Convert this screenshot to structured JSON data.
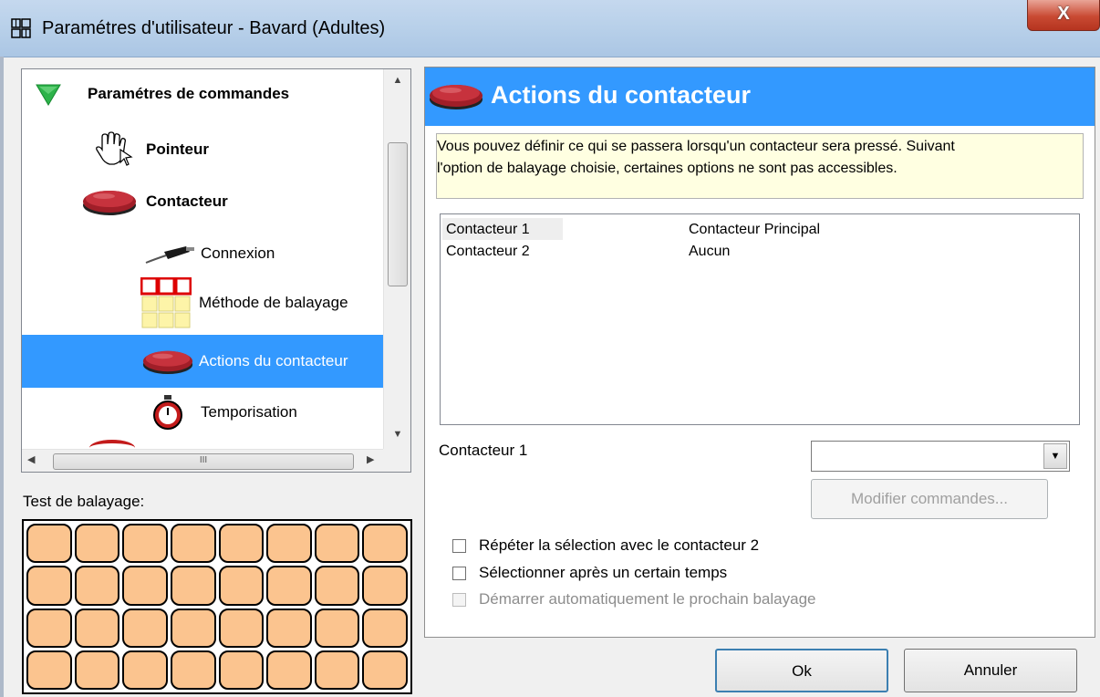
{
  "window": {
    "title": "Paramétres d'utilisateur - Bavard (Adultes)",
    "close_label": "X"
  },
  "tree": {
    "items": [
      {
        "label": "Paramétres de commandes",
        "icon": "green-triangle-icon",
        "bold": true
      },
      {
        "label": "Pointeur",
        "icon": "hand-pointer-icon",
        "bold": true
      },
      {
        "label": "Contacteur",
        "icon": "red-switch-icon",
        "bold": true
      },
      {
        "label": "Connexion",
        "icon": "cable-plug-icon",
        "bold": false
      },
      {
        "label": "Méthode de balayage",
        "icon": "scan-grid-icon",
        "bold": false
      },
      {
        "label": "Actions du contacteur",
        "icon": "red-switch-icon",
        "bold": false,
        "selected": true
      },
      {
        "label": "Temporisation",
        "icon": "stopwatch-icon",
        "bold": false
      }
    ],
    "hscroll_grip": "III"
  },
  "scan_test": {
    "label": "Test de balayage:",
    "rows": 4,
    "cols": 8,
    "cell_color": "#fbc48f"
  },
  "panel": {
    "title": "Actions du contacteur",
    "header_color": "#3399ff",
    "info_line1": "Vous pouvez définir ce qui se passera lorsqu'un contacteur sera pressé. Suivant",
    "info_line2": "l'option de balayage choisie, certaines options ne sont pas accessibles.",
    "list": [
      {
        "name": "Contacteur 1",
        "value": "Contacteur Principal",
        "selected": true
      },
      {
        "name": "Contacteur 2",
        "value": "Aucun",
        "selected": false
      }
    ],
    "contact_label": "Contacteur 1",
    "contact_select_value": "",
    "modify_button": "Modifier commandes...",
    "checks": [
      {
        "label": "Répéter la sélection avec le contacteur 2",
        "checked": false,
        "enabled": true
      },
      {
        "label": "Sélectionner après un certain temps",
        "checked": false,
        "enabled": true
      },
      {
        "label": "Démarrer automatiquement le prochain balayage",
        "checked": false,
        "enabled": false
      }
    ]
  },
  "buttons": {
    "ok": "Ok",
    "cancel": "Annuler"
  }
}
